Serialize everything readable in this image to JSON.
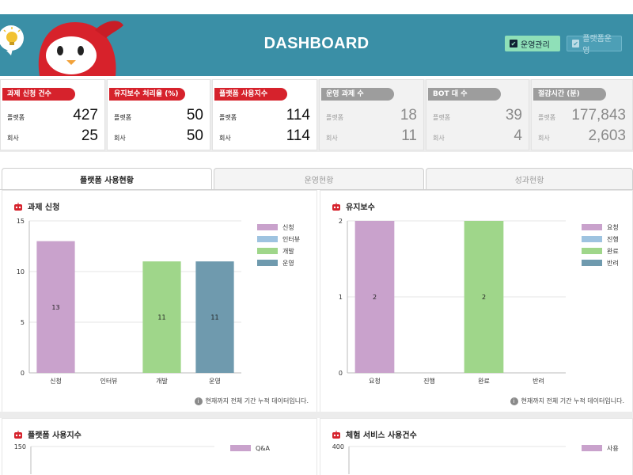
{
  "header": {
    "title": "DASHBOARD",
    "ops_button": "운영관리",
    "platform_button": "플랫폼운영"
  },
  "stat_cards": [
    {
      "title": "과제 신청 건수",
      "style": "red",
      "rows": [
        {
          "label": "플랫폼",
          "value": "427"
        },
        {
          "label": "회사",
          "value": "25"
        }
      ]
    },
    {
      "title": "유지보수 처리율 (%)",
      "style": "red",
      "rows": [
        {
          "label": "플랫폼",
          "value": "50"
        },
        {
          "label": "회사",
          "value": "50"
        }
      ]
    },
    {
      "title": "플랫폼 사용지수",
      "style": "red",
      "rows": [
        {
          "label": "플랫폼",
          "value": "114"
        },
        {
          "label": "회사",
          "value": "114"
        }
      ]
    },
    {
      "title": "운영 과제 수",
      "style": "grey",
      "rows": [
        {
          "label": "플랫폼",
          "value": "18"
        },
        {
          "label": "회사",
          "value": "11"
        }
      ]
    },
    {
      "title": "BOT 대 수",
      "style": "grey",
      "rows": [
        {
          "label": "플랫폼",
          "value": "39"
        },
        {
          "label": "회사",
          "value": "4"
        }
      ]
    },
    {
      "title": "절감시간 (분)",
      "style": "grey",
      "rows": [
        {
          "label": "플랫폼",
          "value": "177,843"
        },
        {
          "label": "회사",
          "value": "2,603"
        }
      ]
    }
  ],
  "tabs": [
    {
      "label": "플랫폼 사용현황",
      "active": true
    },
    {
      "label": "운영현황",
      "active": false
    },
    {
      "label": "성과현황",
      "active": false
    }
  ],
  "panels": {
    "task_request": {
      "title": "과제 신청",
      "note": "현재까지 전체 기간 누적 데이터입니다."
    },
    "maintenance": {
      "title": "유지보수",
      "note": "현재까지 전체 기간 누적 데이터입니다."
    },
    "platform_index": {
      "title": "플랫폼 사용지수"
    },
    "trial_service": {
      "title": "체험 서비스 사용건수"
    }
  },
  "chart_data": [
    {
      "type": "bar",
      "title": "과제 신청",
      "categories": [
        "신청",
        "인터뷰",
        "개발",
        "운영"
      ],
      "values": [
        13,
        0,
        11,
        11
      ],
      "colors": [
        "#c9a2cc",
        "#9ec3e0",
        "#9fd68a",
        "#6f9aae"
      ],
      "legend": [
        "신청",
        "인터뷰",
        "개발",
        "운영"
      ],
      "legend_position": "right",
      "yticks": [
        "0",
        "5",
        "10",
        "15"
      ],
      "ylim": [
        0,
        15
      ],
      "grid": true
    },
    {
      "type": "bar",
      "title": "유지보수",
      "categories": [
        "요청",
        "진행",
        "완료",
        "반려"
      ],
      "values": [
        2,
        0,
        2,
        0
      ],
      "colors": [
        "#c9a2cc",
        "#9ec3e0",
        "#9fd68a",
        "#6f9aae"
      ],
      "legend": [
        "요청",
        "진행",
        "완료",
        "반려"
      ],
      "legend_position": "right",
      "yticks": [
        "0",
        "1",
        "2"
      ],
      "ylim": [
        0,
        2
      ],
      "grid": true
    },
    {
      "type": "bar",
      "title": "플랫폼 사용지수",
      "yticks": [
        "150"
      ],
      "legend": [
        "Q&A"
      ],
      "colors": [
        "#c9a2cc"
      ],
      "legend_position": "right"
    },
    {
      "type": "bar",
      "title": "체험 서비스 사용건수",
      "yticks": [
        "400"
      ],
      "legend": [
        "사용"
      ],
      "colors": [
        "#c9a2cc"
      ],
      "legend_position": "right"
    }
  ]
}
